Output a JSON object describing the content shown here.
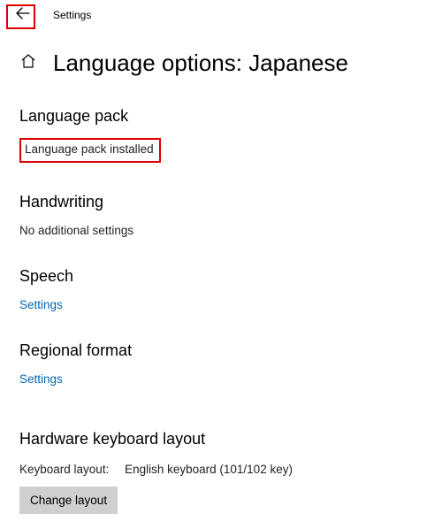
{
  "titlebar": {
    "label": "Settings"
  },
  "header": {
    "title": "Language options: Japanese"
  },
  "sections": {
    "language_pack": {
      "heading": "Language pack",
      "status": "Language pack installed"
    },
    "handwriting": {
      "heading": "Handwriting",
      "status": "No additional settings"
    },
    "speech": {
      "heading": "Speech",
      "link": "Settings"
    },
    "regional_format": {
      "heading": "Regional format",
      "link": "Settings"
    },
    "hardware_keyboard": {
      "heading": "Hardware keyboard layout",
      "label": "Keyboard layout:",
      "value": "English keyboard (101/102 key)",
      "button": "Change layout"
    }
  }
}
